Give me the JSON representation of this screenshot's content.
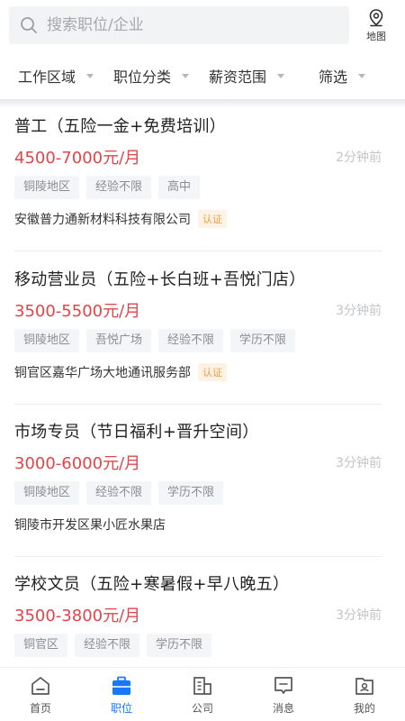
{
  "search": {
    "placeholder": "搜索职位/企业"
  },
  "map": {
    "label": "地图"
  },
  "filters": [
    "工作区域",
    "职位分类",
    "薪资范围",
    "筛选"
  ],
  "jobs": [
    {
      "title": "普工（五险一金+免费培训）",
      "salary": "4500-7000元/月",
      "time": "2分钟前",
      "tags": [
        "铜陵地区",
        "经验不限",
        "高中"
      ],
      "company": "安徽普力通新材料科技有限公司",
      "badge": "认证"
    },
    {
      "title": "移动营业员（五险+长白班+吾悦门店）",
      "salary": "3500-5500元/月",
      "time": "3分钟前",
      "tags": [
        "铜陵地区",
        "吾悦广场",
        "经验不限",
        "学历不限"
      ],
      "company": "铜官区嘉华广场大地通讯服务部",
      "badge": "认证"
    },
    {
      "title": "市场专员（节日福利+晋升空间）",
      "salary": "3000-6000元/月",
      "time": "3分钟前",
      "tags": [
        "铜陵地区",
        "经验不限",
        "学历不限"
      ],
      "company": "铜陵市开发区果小匠水果店",
      "badge": ""
    },
    {
      "title": "学校文员（五险+寒暑假+早八晚五）",
      "salary": "3500-3800元/月",
      "time": "3分钟前",
      "tags": [
        "铜官区",
        "经验不限",
        "学历不限"
      ],
      "company": "",
      "badge": ""
    }
  ],
  "tabs": [
    {
      "label": "首页",
      "icon": "home-icon"
    },
    {
      "label": "职位",
      "icon": "briefcase-icon"
    },
    {
      "label": "公司",
      "icon": "building-icon"
    },
    {
      "label": "消息",
      "icon": "message-icon"
    },
    {
      "label": "我的",
      "icon": "profile-icon"
    }
  ],
  "colors": {
    "accent": "#1677ff",
    "salary": "#e0454a",
    "badge_text": "#e6a04c"
  }
}
